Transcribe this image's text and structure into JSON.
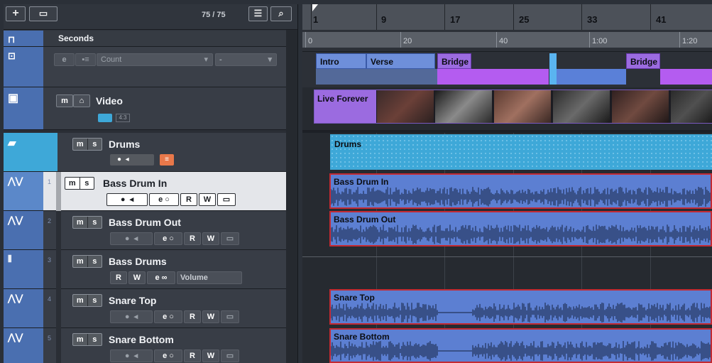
{
  "toolbar": {
    "add_icon": "plus-icon",
    "folder_add_icon": "folder-add-icon",
    "track_count": "75 / 75",
    "list_icon": "list-icon",
    "search_icon": "search-icon"
  },
  "ruler_track": {
    "label": "Seconds",
    "icon": "ruler-icon"
  },
  "signature_track": {
    "count_placeholder": "Count",
    "dropdown2": "-",
    "edit_btn": "e",
    "icon": "chord-icon"
  },
  "video_track": {
    "name": "Video",
    "m": "m",
    "lock_icon": "lock-icon",
    "icon": "video-icon",
    "format": "4:3"
  },
  "folder_track": {
    "name": "Drums",
    "m": "m",
    "s": "s",
    "icon": "folder-icon"
  },
  "tracks": [
    {
      "num": "1",
      "name": "Bass Drum In",
      "m": "m",
      "s": "s",
      "r": "R",
      "w": "W",
      "e": "e",
      "selected": true
    },
    {
      "num": "2",
      "name": "Bass Drum Out",
      "m": "m",
      "s": "s",
      "r": "R",
      "w": "W",
      "e": "e",
      "selected": false
    },
    {
      "num": "3",
      "name": "Bass Drums",
      "m": "m",
      "s": "s",
      "r": "R",
      "w": "W",
      "e": "e",
      "automation": "Volume"
    },
    {
      "num": "4",
      "name": "Snare Top",
      "m": "m",
      "s": "s",
      "r": "R",
      "w": "W",
      "e": "e"
    },
    {
      "num": "5",
      "name": "Snare Bottom",
      "m": "m",
      "s": "s",
      "r": "R",
      "w": "W",
      "e": "e"
    }
  ],
  "ruler": {
    "bars": [
      "1",
      "9",
      "17",
      "25",
      "33",
      "41"
    ],
    "times": [
      "0",
      "20",
      "40",
      "1:00",
      "1:20"
    ]
  },
  "arranger": {
    "segments": [
      "Intro",
      "Verse",
      "Bridge",
      "Bridge"
    ]
  },
  "video_events": {
    "label": "Live Forever"
  },
  "events": {
    "drums_folder": "Drums",
    "bass_drum_in": "Bass Drum In",
    "bass_drum_out": "Bass Drum Out",
    "snare_top": "Snare Top",
    "snare_bottom": "Snare Bottom"
  },
  "colors": {
    "track_blue": "#4a6fb0",
    "event_blue": "#5c7fd2",
    "event_selected_border": "#c32a33",
    "arranger_purple": "#a35cde",
    "folder_cyan": "#3ea8d8"
  }
}
